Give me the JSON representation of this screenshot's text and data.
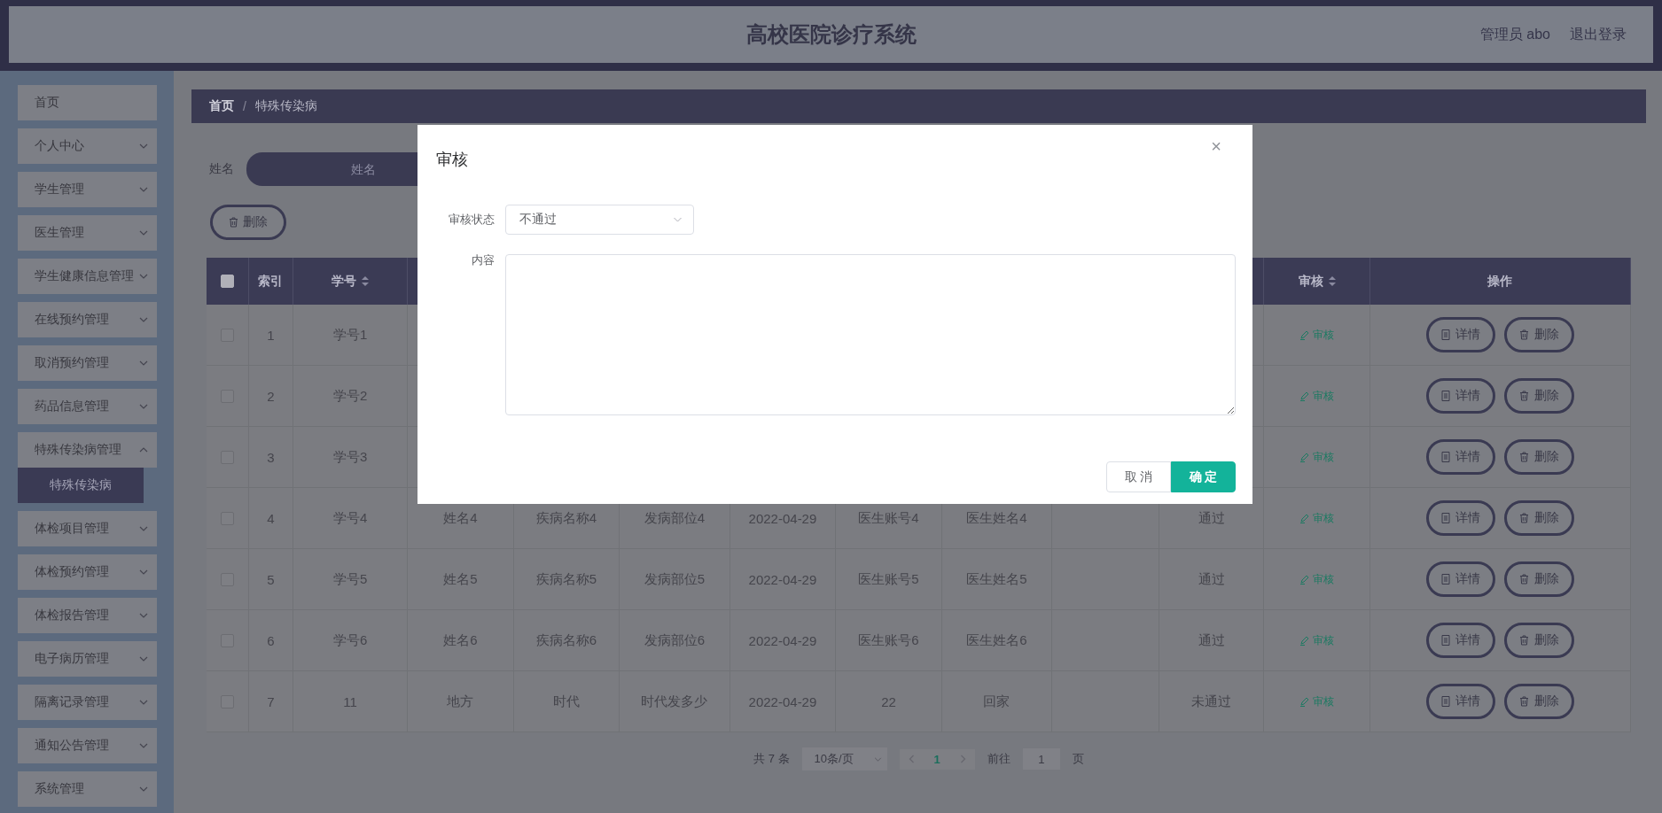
{
  "header": {
    "title": "高校医院诊疗系统",
    "user": "管理员 abo",
    "logout": "退出登录"
  },
  "sidebar": {
    "items": [
      {
        "label": "首页",
        "kind": "link"
      },
      {
        "label": "个人中心",
        "kind": "submenu",
        "expanded": false
      },
      {
        "label": "学生管理",
        "kind": "submenu",
        "expanded": false
      },
      {
        "label": "医生管理",
        "kind": "submenu",
        "expanded": false
      },
      {
        "label": "学生健康信息管理",
        "kind": "submenu",
        "expanded": false
      },
      {
        "label": "在线预约管理",
        "kind": "submenu",
        "expanded": false
      },
      {
        "label": "取消预约管理",
        "kind": "submenu",
        "expanded": false
      },
      {
        "label": "药品信息管理",
        "kind": "submenu",
        "expanded": false
      },
      {
        "label": "特殊传染病管理",
        "kind": "submenu",
        "expanded": true,
        "children": [
          {
            "label": "特殊传染病",
            "selected": true
          }
        ]
      },
      {
        "label": "体检项目管理",
        "kind": "submenu",
        "expanded": false
      },
      {
        "label": "体检预约管理",
        "kind": "submenu",
        "expanded": false
      },
      {
        "label": "体检报告管理",
        "kind": "submenu",
        "expanded": false
      },
      {
        "label": "电子病历管理",
        "kind": "submenu",
        "expanded": false
      },
      {
        "label": "隔离记录管理",
        "kind": "submenu",
        "expanded": false
      },
      {
        "label": "通知公告管理",
        "kind": "submenu",
        "expanded": false
      },
      {
        "label": "系统管理",
        "kind": "submenu",
        "expanded": false
      }
    ]
  },
  "breadcrumb": [
    "首页",
    "特殊传染病"
  ],
  "breadcrumb_separator": "/",
  "search": {
    "label": "姓名",
    "placeholder": "姓名"
  },
  "delete_button": "删除",
  "table": {
    "select_all_checked": false,
    "columns": [
      {
        "label": "索引",
        "sortable": false
      },
      {
        "label": "学号",
        "sortable": true
      },
      {},
      {},
      {},
      {},
      {},
      {},
      {},
      {},
      {
        "label": "审核",
        "sortable": true
      },
      {
        "label": "操作",
        "sortable": false
      }
    ],
    "rows": [
      {
        "checked": false,
        "cells": [
          "1",
          "学号1"
        ],
        "review": "审核",
        "actions": [
          {
            "kind": "detail",
            "label": "详情"
          },
          {
            "kind": "delete",
            "label": "删除"
          }
        ]
      },
      {
        "checked": false,
        "cells": [
          "2",
          "学号2"
        ],
        "review": "审核",
        "actions": [
          {
            "kind": "detail",
            "label": "详情"
          },
          {
            "kind": "delete",
            "label": "删除"
          }
        ]
      },
      {
        "checked": false,
        "cells": [
          "3",
          "学号3"
        ],
        "review": "审核",
        "actions": [
          {
            "kind": "detail",
            "label": "详情"
          },
          {
            "kind": "delete",
            "label": "删除"
          }
        ]
      },
      {
        "checked": false,
        "cells": [
          "4",
          "学号4",
          "姓名4",
          "疾病名称4",
          "发病部位4",
          "2022-04-29",
          "医生账号4",
          "医生姓名4",
          "",
          "通过"
        ],
        "review": "审核",
        "actions": [
          {
            "kind": "detail",
            "label": "详情"
          },
          {
            "kind": "delete",
            "label": "删除"
          }
        ]
      },
      {
        "checked": false,
        "cells": [
          "5",
          "学号5",
          "姓名5",
          "疾病名称5",
          "发病部位5",
          "2022-04-29",
          "医生账号5",
          "医生姓名5",
          "",
          "通过"
        ],
        "review": "审核",
        "actions": [
          {
            "kind": "detail",
            "label": "详情"
          },
          {
            "kind": "delete",
            "label": "删除"
          }
        ]
      },
      {
        "checked": false,
        "cells": [
          "6",
          "学号6",
          "姓名6",
          "疾病名称6",
          "发病部位6",
          "2022-04-29",
          "医生账号6",
          "医生姓名6",
          "",
          "通过"
        ],
        "review": "审核",
        "actions": [
          {
            "kind": "detail",
            "label": "详情"
          },
          {
            "kind": "delete",
            "label": "删除"
          }
        ]
      },
      {
        "checked": false,
        "cells": [
          "7",
          "11",
          "地方",
          "时代",
          "时代发多少",
          "2022-04-29",
          "22",
          "回家",
          "",
          "未通过"
        ],
        "review": "审核",
        "actions": [
          {
            "kind": "detail",
            "label": "详情"
          },
          {
            "kind": "delete",
            "label": "删除"
          }
        ]
      }
    ]
  },
  "pagination": {
    "total": "共 7 条",
    "page_size": "10条/页",
    "pages": [
      {
        "label": "1",
        "selected": true
      }
    ],
    "goto_label": "前往",
    "goto_value": "1",
    "goto_suffix": "页"
  },
  "dialog": {
    "title": "审核",
    "close": "×",
    "status_label": "审核状态",
    "status_value": "不通过",
    "content_label": "内容",
    "cancel": "取 消",
    "confirm": "确 定"
  }
}
